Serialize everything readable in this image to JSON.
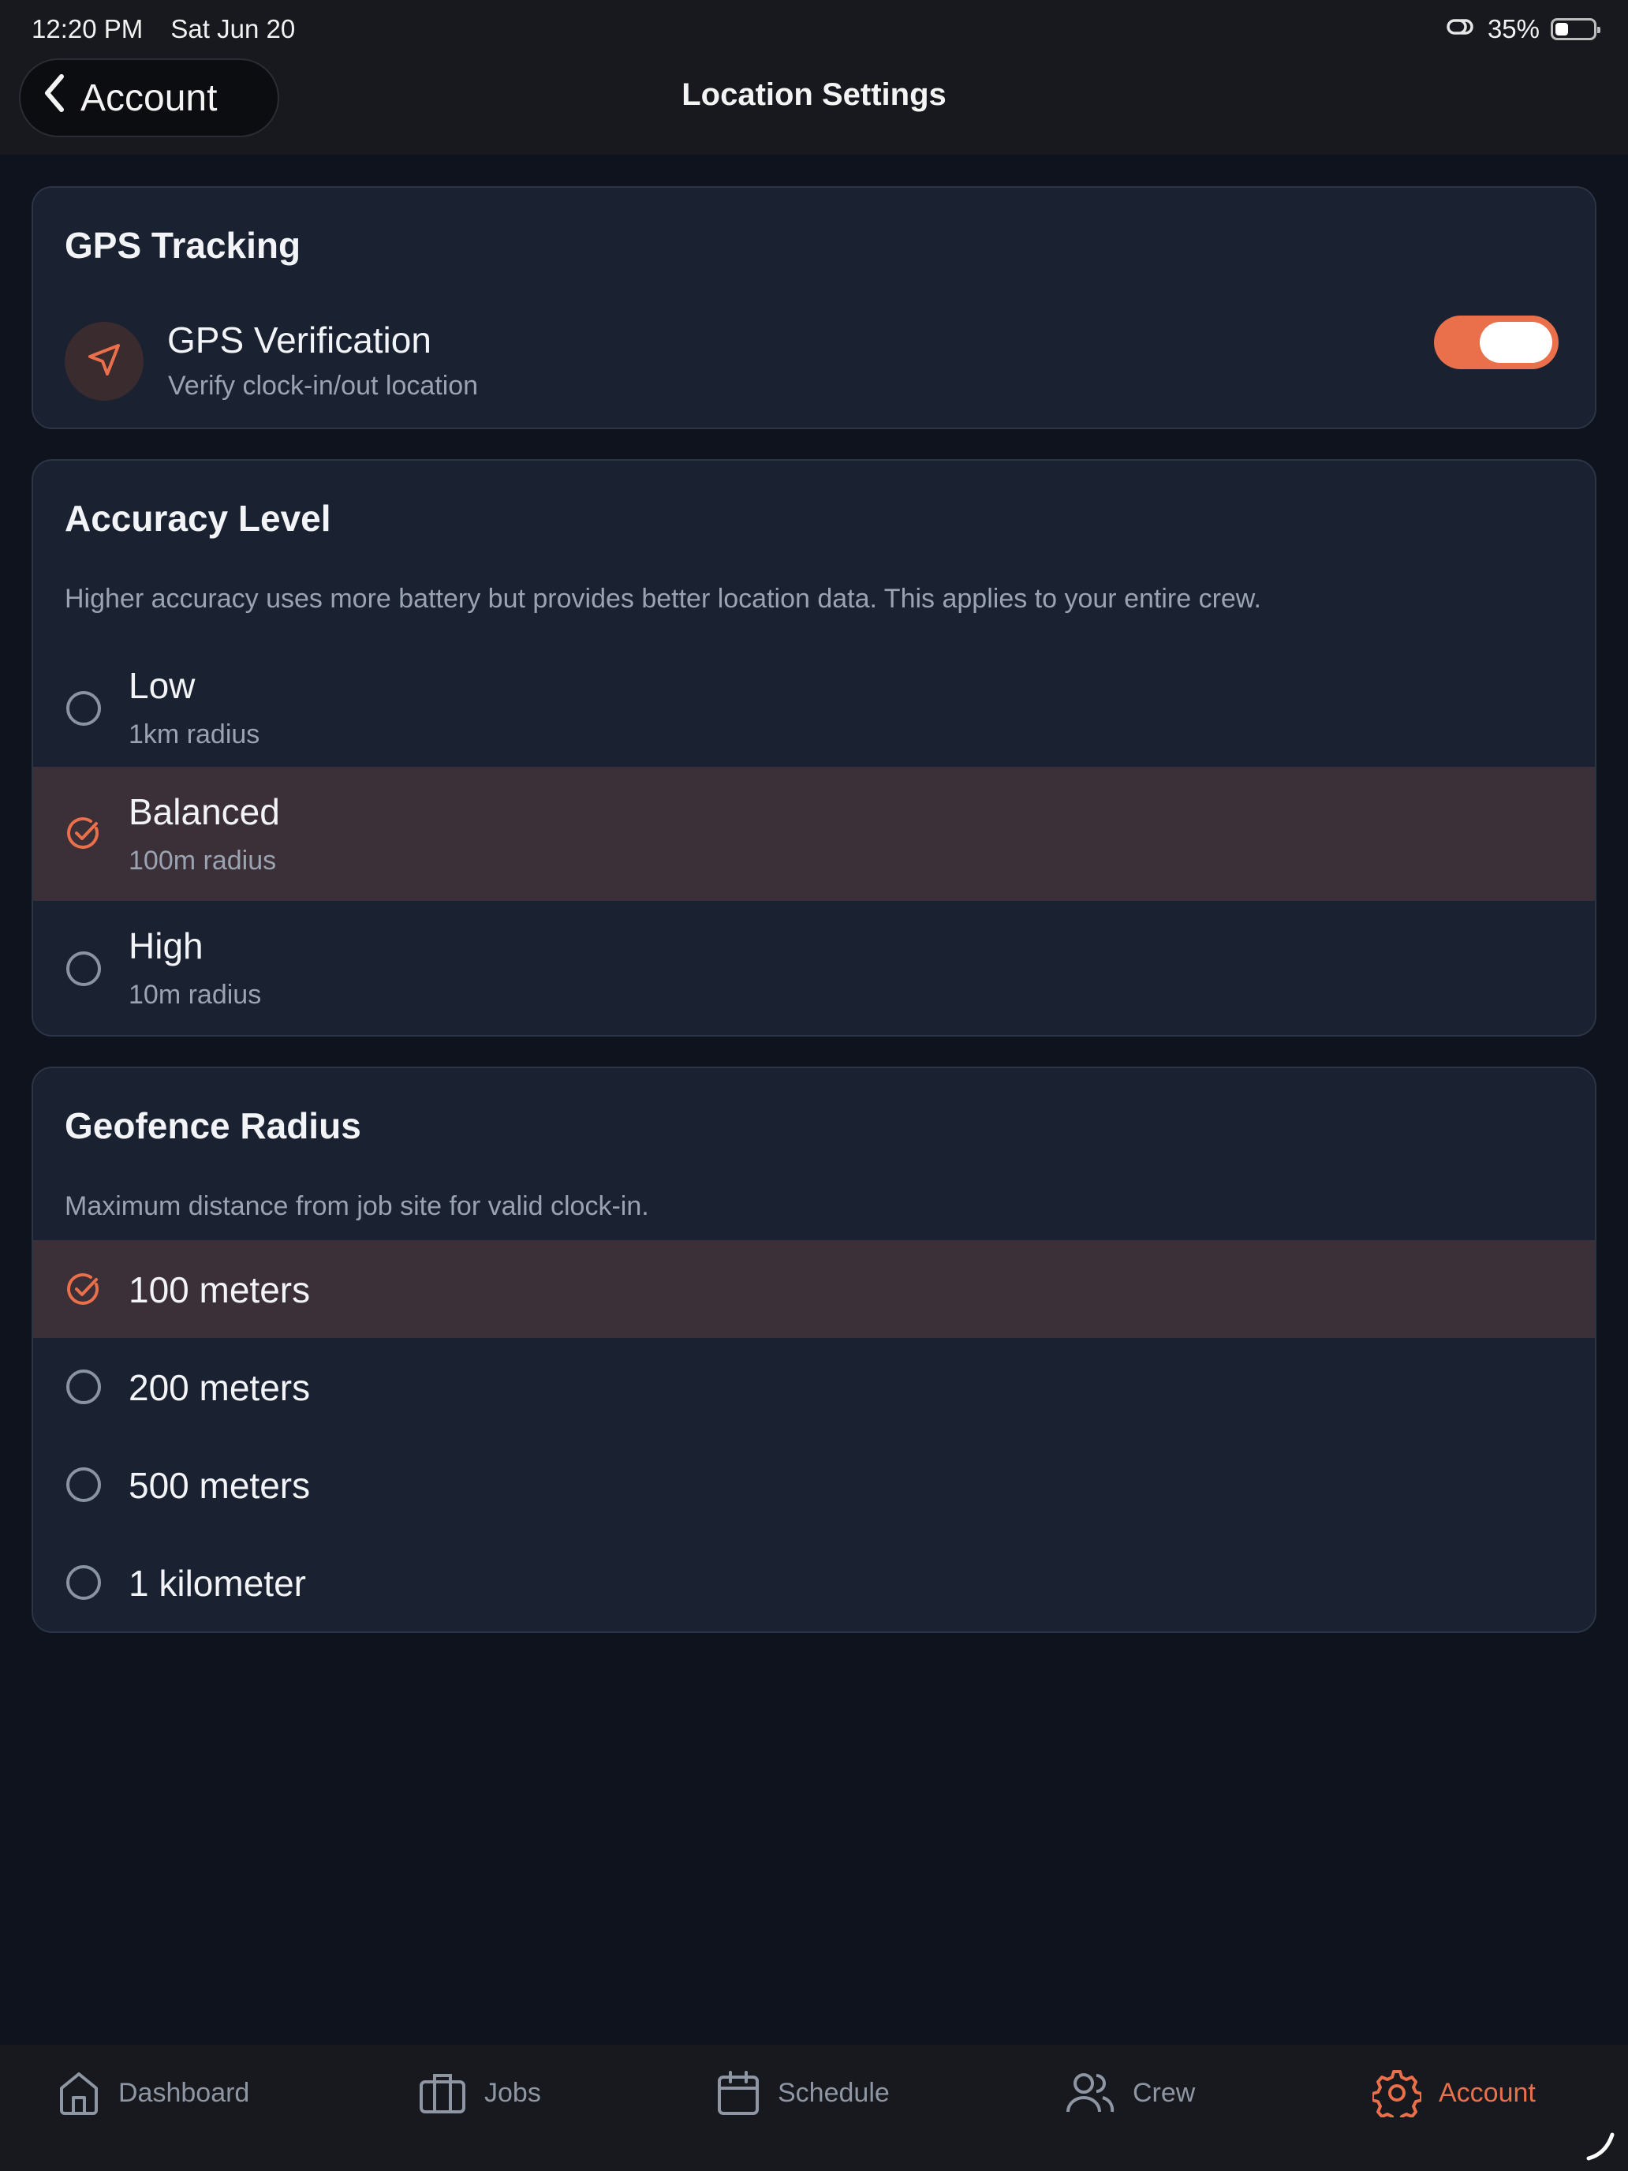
{
  "status_bar": {
    "time": "12:20 PM",
    "date": "Sat Jun 20",
    "battery_percent": "35%",
    "battery_level": 0.35,
    "icons": [
      "link-icon",
      "battery-icon"
    ]
  },
  "header": {
    "back_label": "Account",
    "title": "Location Settings"
  },
  "gps_tracking": {
    "title": "GPS Tracking",
    "verification": {
      "label": "GPS Verification",
      "description": "Verify clock-in/out location",
      "enabled": true,
      "icon": "navigation-arrow-icon"
    }
  },
  "accuracy": {
    "title": "Accuracy Level",
    "description": "Higher accuracy uses more battery but provides better location data. This applies to your entire crew.",
    "options": [
      {
        "label": "Low",
        "sub": "1km radius",
        "selected": false
      },
      {
        "label": "Balanced",
        "sub": "100m radius",
        "selected": true
      },
      {
        "label": "High",
        "sub": "10m radius",
        "selected": false
      }
    ]
  },
  "geofence": {
    "title": "Geofence Radius",
    "description": "Maximum distance from job site for valid clock-in.",
    "options": [
      {
        "label": "100 meters",
        "selected": true
      },
      {
        "label": "200 meters",
        "selected": false
      },
      {
        "label": "500 meters",
        "selected": false
      },
      {
        "label": "1 kilometer",
        "selected": false
      }
    ]
  },
  "tabs": [
    {
      "label": "Dashboard",
      "icon": "home-icon",
      "active": false
    },
    {
      "label": "Jobs",
      "icon": "briefcase-icon",
      "active": false
    },
    {
      "label": "Schedule",
      "icon": "calendar-icon",
      "active": false
    },
    {
      "label": "Crew",
      "icon": "users-icon",
      "active": false
    },
    {
      "label": "Account",
      "icon": "gear-icon",
      "active": true
    }
  ],
  "colors": {
    "accent": "#ea6f4b",
    "background": "#0f131d",
    "card": "#1a2231",
    "selected_row": "#3b2f38",
    "muted_text": "#9aa3b1"
  }
}
